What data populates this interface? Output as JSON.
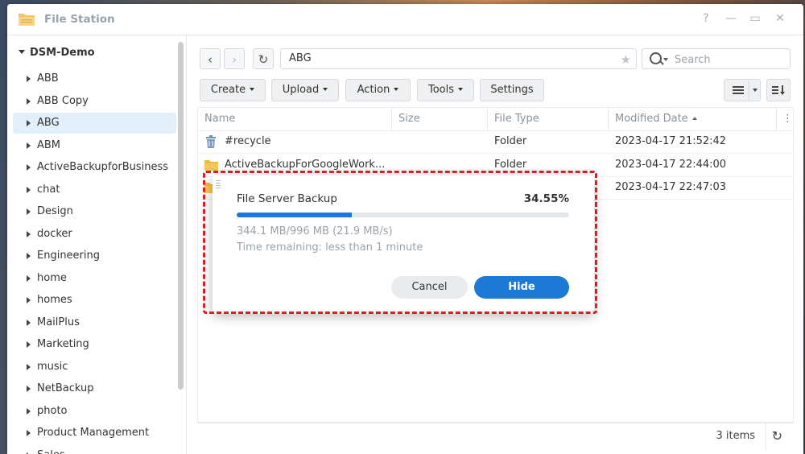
{
  "window": {
    "title": "File Station"
  },
  "window_controls": {
    "help": "?",
    "minimize": "—",
    "maximize": "▭",
    "close": "✕"
  },
  "sidebar": {
    "root": "DSM-Demo",
    "items": [
      {
        "label": "ABB"
      },
      {
        "label": "ABB Copy"
      },
      {
        "label": "ABG",
        "selected": true
      },
      {
        "label": "ABM"
      },
      {
        "label": "ActiveBackupforBusiness"
      },
      {
        "label": "chat"
      },
      {
        "label": "Design"
      },
      {
        "label": "docker"
      },
      {
        "label": "Engineering"
      },
      {
        "label": "home"
      },
      {
        "label": "homes"
      },
      {
        "label": "MailPlus"
      },
      {
        "label": "Marketing"
      },
      {
        "label": "music"
      },
      {
        "label": "NetBackup"
      },
      {
        "label": "photo"
      },
      {
        "label": "Product Management"
      },
      {
        "label": "Sales"
      }
    ]
  },
  "nav": {
    "back_glyph": "‹",
    "forward_glyph": "›",
    "refresh_glyph": "↻",
    "path": "ABG",
    "favorite_glyph": "★"
  },
  "search": {
    "placeholder": "Search"
  },
  "toolbar": {
    "create": "Create",
    "upload": "Upload",
    "action": "Action",
    "tools": "Tools",
    "settings": "Settings"
  },
  "file_list": {
    "columns": {
      "name": "Name",
      "size": "Size",
      "type": "File Type",
      "modified": "Modified Date"
    },
    "rows": [
      {
        "name": "#recycle",
        "size": "",
        "type": "Folder",
        "modified": "2023-04-17 21:52:42",
        "icon": "trash-icon"
      },
      {
        "name": "ActiveBackupForGoogleWork...",
        "size": "",
        "type": "Folder",
        "modified": "2023-04-17 22:44:00",
        "icon": "folder-icon"
      },
      {
        "name": "",
        "size": "",
        "type": "",
        "modified": "2023-04-17 22:47:03",
        "icon": "folder-icon"
      }
    ],
    "footer": {
      "count": "3 items",
      "refresh_glyph": "↻"
    }
  },
  "dialog": {
    "title": "File Server Backup",
    "percent_label": "34.55%",
    "progress": 0.3455,
    "transferred": "344.1 MB/996 MB (21.9 MB/s)",
    "remaining": "Time remaining: less than 1 minute",
    "cancel": "Cancel",
    "hide": "Hide"
  },
  "colors": {
    "accent": "#1b7ad6",
    "highlight": "#d81f26",
    "selected_row": "#e3eefb"
  }
}
